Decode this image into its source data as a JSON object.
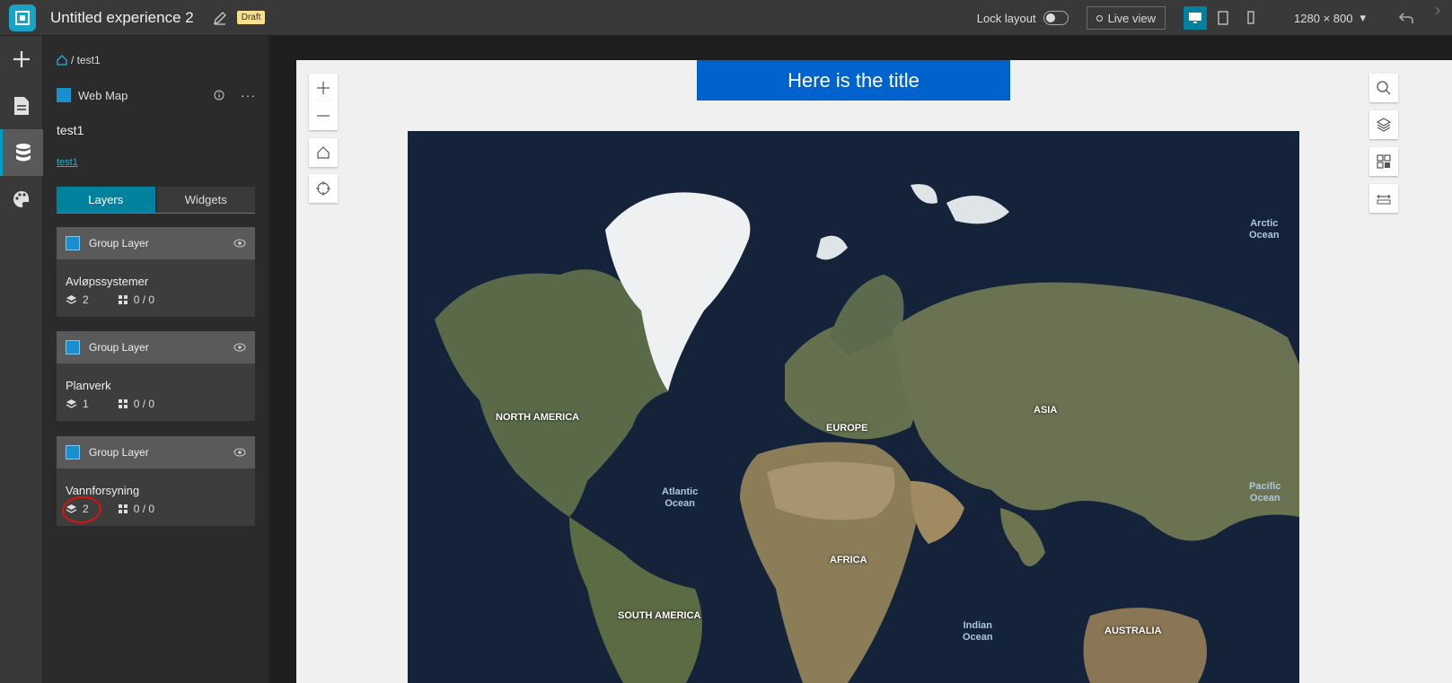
{
  "header": {
    "app_title": "Untitled experience 2",
    "draft_badge": "Draft",
    "lock_layout_label": "Lock layout",
    "live_view_label": "Live view",
    "screen_size": "1280 × 800"
  },
  "panel": {
    "breadcrumb": "/ test1",
    "datasource_type": "Web Map",
    "datasource_name": "test1",
    "datasource_link": "test1",
    "tabs": {
      "layers": "Layers",
      "widgets": "Widgets"
    },
    "groups": [
      {
        "header": "Group Layer",
        "title": "Avløpssystemer",
        "layer_count": "2",
        "widget_count": "0 / 0"
      },
      {
        "header": "Group Layer",
        "title": "Planverk",
        "layer_count": "1",
        "widget_count": "0 / 0"
      },
      {
        "header": "Group Layer",
        "title": "Vannforsyning",
        "layer_count": "2",
        "widget_count": "0 / 0"
      }
    ]
  },
  "canvas": {
    "title": "Here is the title"
  },
  "map": {
    "labels": {
      "north_america": "NORTH AMERICA",
      "europe": "EUROPE",
      "asia": "ASIA",
      "africa": "AFRICA",
      "south_america": "SOUTH AMERICA",
      "australia": "AUSTRALIA"
    },
    "oceans": {
      "arctic_1": "Arctic",
      "arctic_2": "Ocean",
      "atlantic_1": "Atlantic",
      "atlantic_2": "Ocean",
      "pacific_1": "Pacific",
      "pacific_2": "Ocean",
      "indian_1": "Indian",
      "indian_2": "Ocean"
    }
  },
  "colors": {
    "accent": "#00819e",
    "title_bar": "#0062cc",
    "annotation": "#e01010"
  }
}
